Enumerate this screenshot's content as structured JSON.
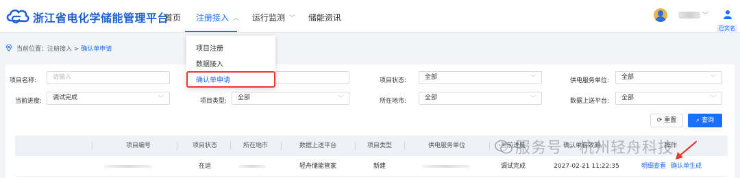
{
  "header": {
    "app_title": "浙江省电化学储能管理平台",
    "nav": [
      {
        "label": "首页"
      },
      {
        "label": "注册接入"
      },
      {
        "label": "运行监测"
      },
      {
        "label": "储能资讯"
      }
    ],
    "realname_badge": "已实名"
  },
  "nav_dropdown": {
    "items": [
      "项目注册",
      "数据接入",
      "确认单申请"
    ]
  },
  "breadcrumb": {
    "prefix": "当前位置：注册接入 > ",
    "current": "确认单申请"
  },
  "filters": {
    "project_name": {
      "label": "项目名称:",
      "placeholder": "请输入"
    },
    "project_status": {
      "label": "项目状态:",
      "value": "全部"
    },
    "power_unit": {
      "label": "供电服务单位:",
      "value": "全部"
    },
    "progress": {
      "label": "当前进度:",
      "value": "调试完成"
    },
    "project_type": {
      "label": "项目类型:",
      "value": "全部"
    },
    "region": {
      "label": "所在地市:",
      "value": "全部"
    },
    "upload_platform": {
      "label": "数据上送平台:",
      "value": "全部"
    }
  },
  "buttons": {
    "reset": "重置",
    "query": "查询"
  },
  "table": {
    "columns": [
      "项目编号",
      "项目状态",
      "所在地市",
      "数据上送平台",
      "项目类型",
      "供电服务单位",
      "当前进度",
      "确认单有效期",
      "操作"
    ],
    "row": {
      "status": "在运",
      "platform": "轻舟储能管家",
      "type": "新建",
      "progress": "调试完成",
      "valid_until": "2027-02-21 11:22:35",
      "op_view": "明细查看",
      "op_generate": "确认单生成"
    }
  },
  "watermark": "服务号 · 杭州轻舟科技",
  "colors": {
    "brand": "#1a5fcf",
    "accent": "#1a6fff",
    "highlight_box": "#e8392c"
  }
}
